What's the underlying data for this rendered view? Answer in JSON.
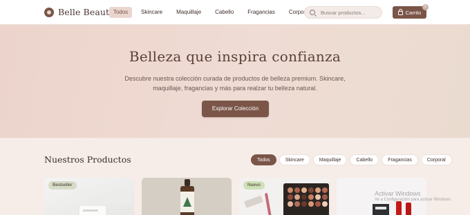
{
  "brand": {
    "name": "Belle Beauty",
    "logo_icon": "flower-logo-icon",
    "accent": "#7a5548"
  },
  "nav": {
    "items": [
      {
        "label": "Todos",
        "active": true
      },
      {
        "label": "Skincare",
        "active": false
      },
      {
        "label": "Maquillaje",
        "active": false
      },
      {
        "label": "Cabello",
        "active": false
      },
      {
        "label": "Fragancias",
        "active": false
      },
      {
        "label": "Corporal",
        "active": false
      }
    ]
  },
  "search": {
    "placeholder": "Buscar productos...",
    "value": "",
    "icon": "search-icon"
  },
  "cart": {
    "label": "Carrito",
    "count": "0",
    "icon": "shopping-bag-icon"
  },
  "hero": {
    "title": "Belleza que inspira confianza",
    "subtitle": "Descubre nuestra colección curada de productos de belleza premium. Skincare, maquillaje, fragancias y más para realzar tu belleza natural.",
    "cta": "Explorar Colección"
  },
  "products": {
    "title": "Nuestros Productos",
    "filters": [
      {
        "label": "Todos",
        "active": true
      },
      {
        "label": "Skincare",
        "active": false
      },
      {
        "label": "Maquillaje",
        "active": false
      },
      {
        "label": "Cabello",
        "active": false
      },
      {
        "label": "Fragancias",
        "active": false
      },
      {
        "label": "Corporal",
        "active": false
      }
    ],
    "cards": [
      {
        "badge": "Bestseller",
        "image": "skincare-cream-tube-image"
      },
      {
        "badge": "",
        "image": "dropper-bottle-image"
      },
      {
        "badge": "Nuevo",
        "image": "eyeshadow-palette-image"
      },
      {
        "badge": "",
        "image": "lipstick-products-image"
      }
    ]
  },
  "watermark": {
    "line1": "Activar Windows",
    "line2": "Ve a Configuración para activar Windows."
  }
}
